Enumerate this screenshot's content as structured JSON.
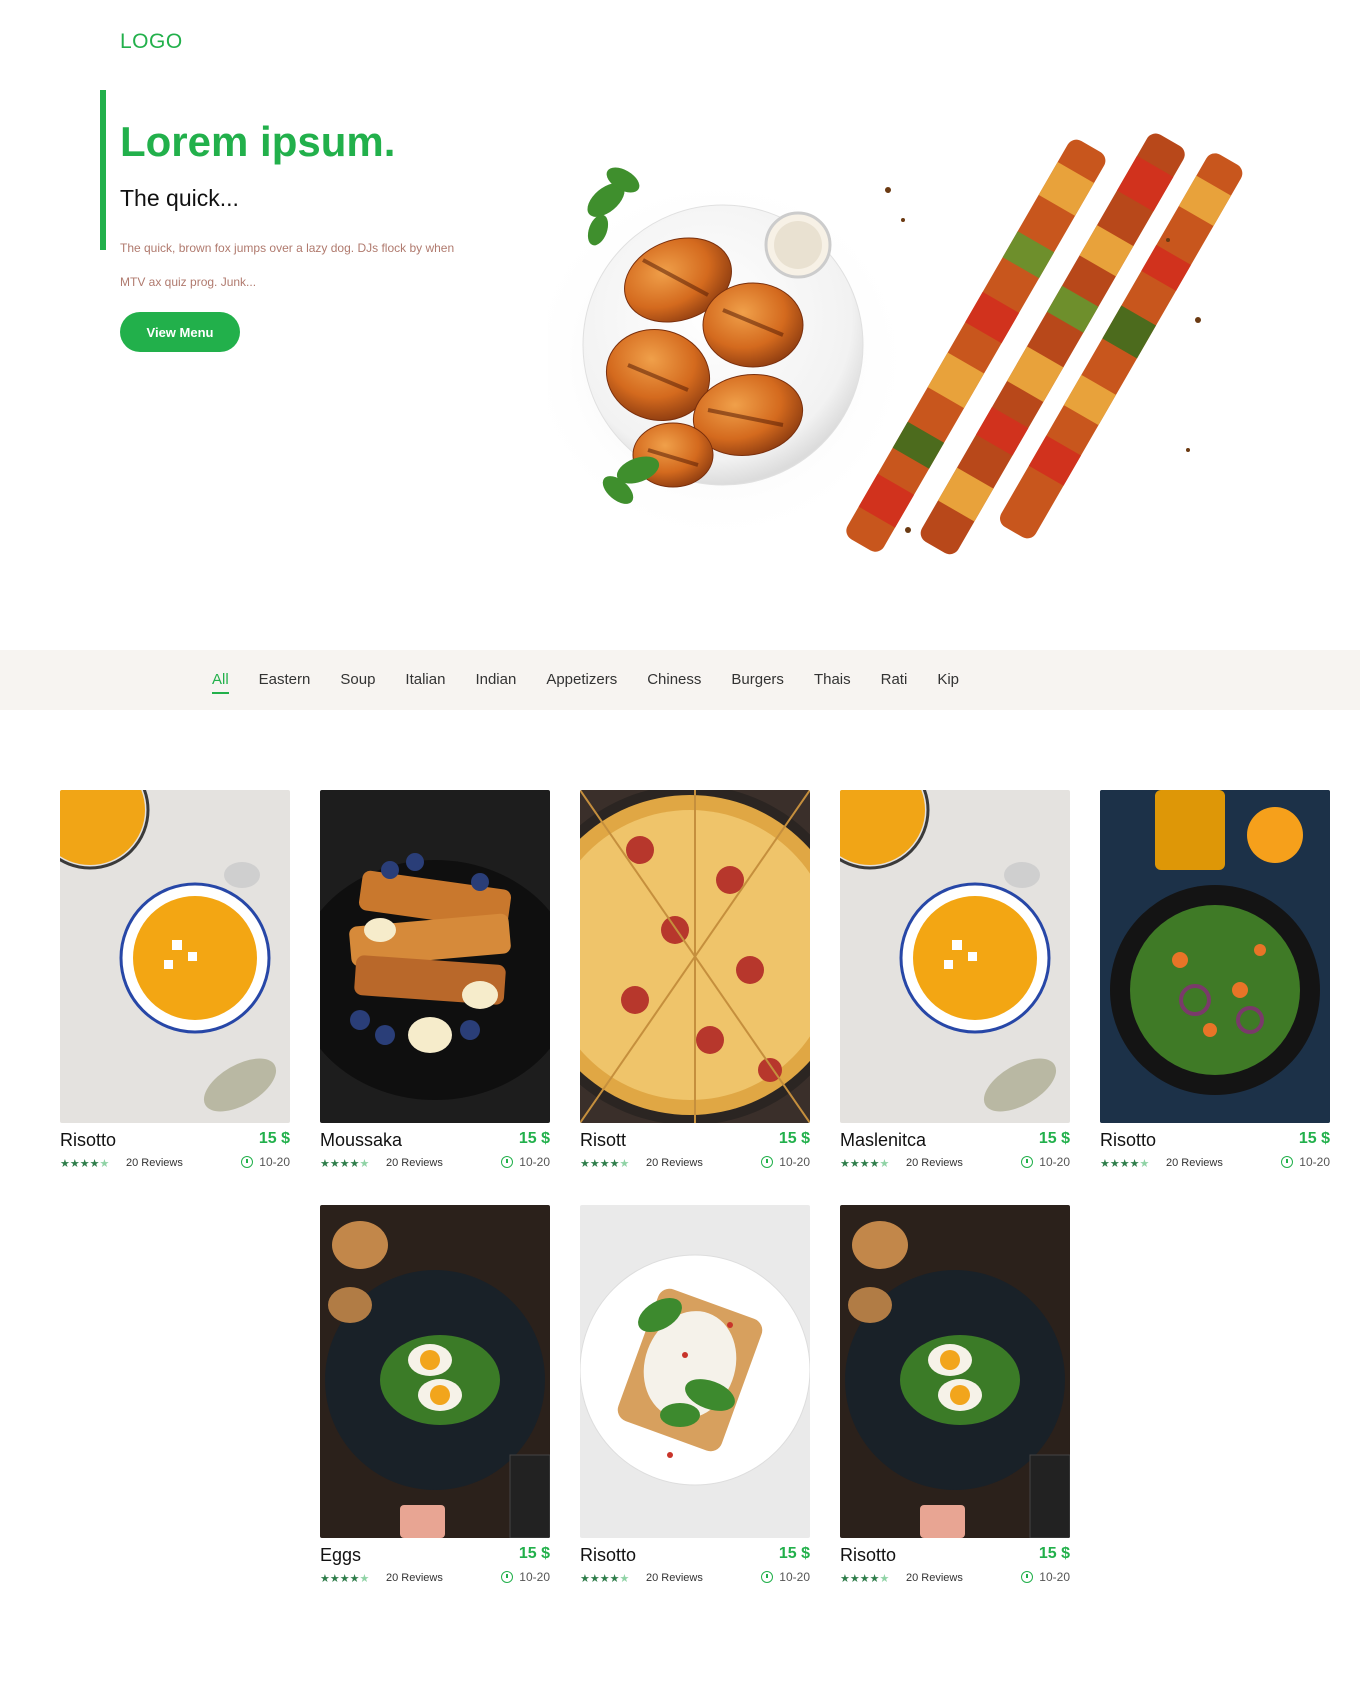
{
  "header": {
    "logo": "LOGO"
  },
  "hero": {
    "title": "Lorem ipsum.",
    "subtitle": "The quick...",
    "description": "The quick, brown fox jumps over a lazy dog. DJs flock by when MTV ax quiz prog. Junk...",
    "cta_label": "View Menu"
  },
  "tabs": [
    {
      "label": "All",
      "active": true
    },
    {
      "label": "Eastern"
    },
    {
      "label": "Soup"
    },
    {
      "label": "Italian"
    },
    {
      "label": "Indian"
    },
    {
      "label": "Appetizers"
    },
    {
      "label": "Chiness"
    },
    {
      "label": "Burgers"
    },
    {
      "label": "Thais"
    },
    {
      "label": "Rati"
    },
    {
      "label": "Kip"
    }
  ],
  "dishes": [
    {
      "name": "Risotto",
      "price": "15 $",
      "rating": 4,
      "reviews": "20 Reviews",
      "time": "10-20",
      "image": "pumpkin-soup"
    },
    {
      "name": "Moussaka",
      "price": "15 $",
      "rating": 4,
      "reviews": "20 Reviews",
      "time": "10-20",
      "image": "french-toast"
    },
    {
      "name": "Risott",
      "price": "15 $",
      "rating": 4,
      "reviews": "20 Reviews",
      "time": "10-20",
      "image": "pizza"
    },
    {
      "name": "Maslenitca",
      "price": "15 $",
      "rating": 4,
      "reviews": "20 Reviews",
      "time": "10-20",
      "image": "pumpkin-soup"
    },
    {
      "name": "Risotto",
      "price": "15 $",
      "rating": 4,
      "reviews": "20 Reviews",
      "time": "10-20",
      "image": "salad"
    },
    {
      "name": "Eggs",
      "price": "15 $",
      "rating": 4,
      "reviews": "20 Reviews",
      "time": "10-20",
      "image": "egg-toast-dark"
    },
    {
      "name": "Risotto",
      "price": "15 $",
      "rating": 4,
      "reviews": "20 Reviews",
      "time": "10-20",
      "image": "egg-toast-light"
    },
    {
      "name": "Risotto",
      "price": "15 $",
      "rating": 4,
      "reviews": "20 Reviews",
      "time": "10-20",
      "image": "egg-toast-dark"
    }
  ],
  "colors": {
    "accent": "#22b04b",
    "band": "#f7f4f1",
    "desc": "#b07a6e"
  }
}
